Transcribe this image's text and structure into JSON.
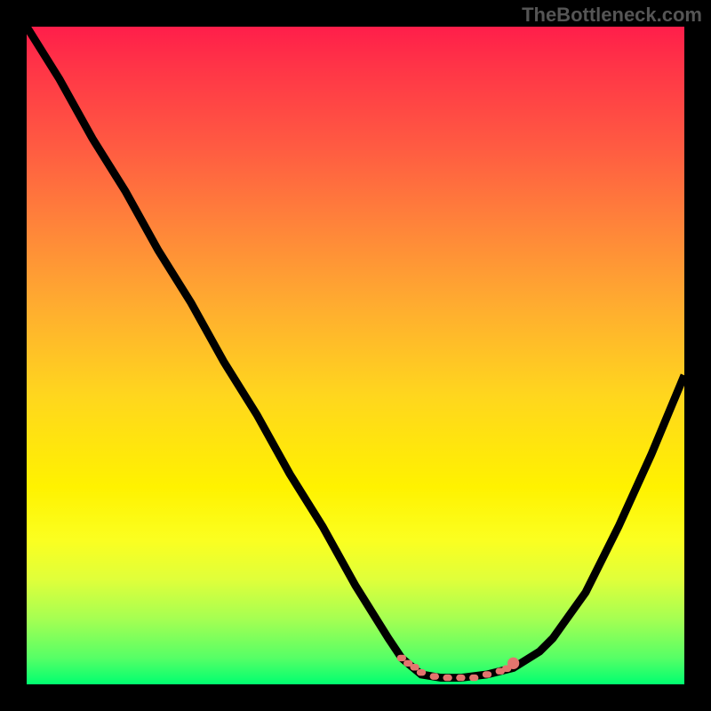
{
  "watermark": "TheBottleneck.com",
  "chart_data": {
    "type": "line",
    "title": "",
    "xlabel": "",
    "ylabel": "",
    "xlim": [
      0,
      100
    ],
    "ylim": [
      0,
      100
    ],
    "grid": false,
    "legend": false,
    "series": [
      {
        "name": "bottleneck-curve",
        "color": "#000000",
        "x": [
          0,
          5,
          10,
          15,
          20,
          25,
          30,
          35,
          40,
          45,
          50,
          55,
          57,
          60,
          63,
          66,
          70,
          74,
          78,
          80,
          85,
          90,
          95,
          100
        ],
        "values": [
          100,
          92,
          83,
          75,
          66,
          58,
          49,
          41,
          32,
          24,
          15,
          7,
          4,
          1.5,
          1,
          1,
          1.5,
          2.5,
          5,
          7,
          14,
          24,
          35,
          47
        ]
      },
      {
        "name": "optimal-markers",
        "color": "#e2756e",
        "type": "marker-line",
        "x": [
          57,
          58,
          59,
          60,
          62,
          64,
          66,
          68,
          70,
          72,
          73,
          74
        ],
        "values": [
          4,
          3.2,
          2.6,
          1.8,
          1.2,
          1,
          1,
          1,
          1.5,
          2,
          2.4,
          3.2
        ]
      }
    ],
    "background_gradient": [
      {
        "pos": 0,
        "color": "#ff1e4a"
      },
      {
        "pos": 18,
        "color": "#ff5a42"
      },
      {
        "pos": 42,
        "color": "#ffab30"
      },
      {
        "pos": 70,
        "color": "#fff200"
      },
      {
        "pos": 90,
        "color": "#a6ff52"
      },
      {
        "pos": 100,
        "color": "#00ff70"
      }
    ]
  }
}
